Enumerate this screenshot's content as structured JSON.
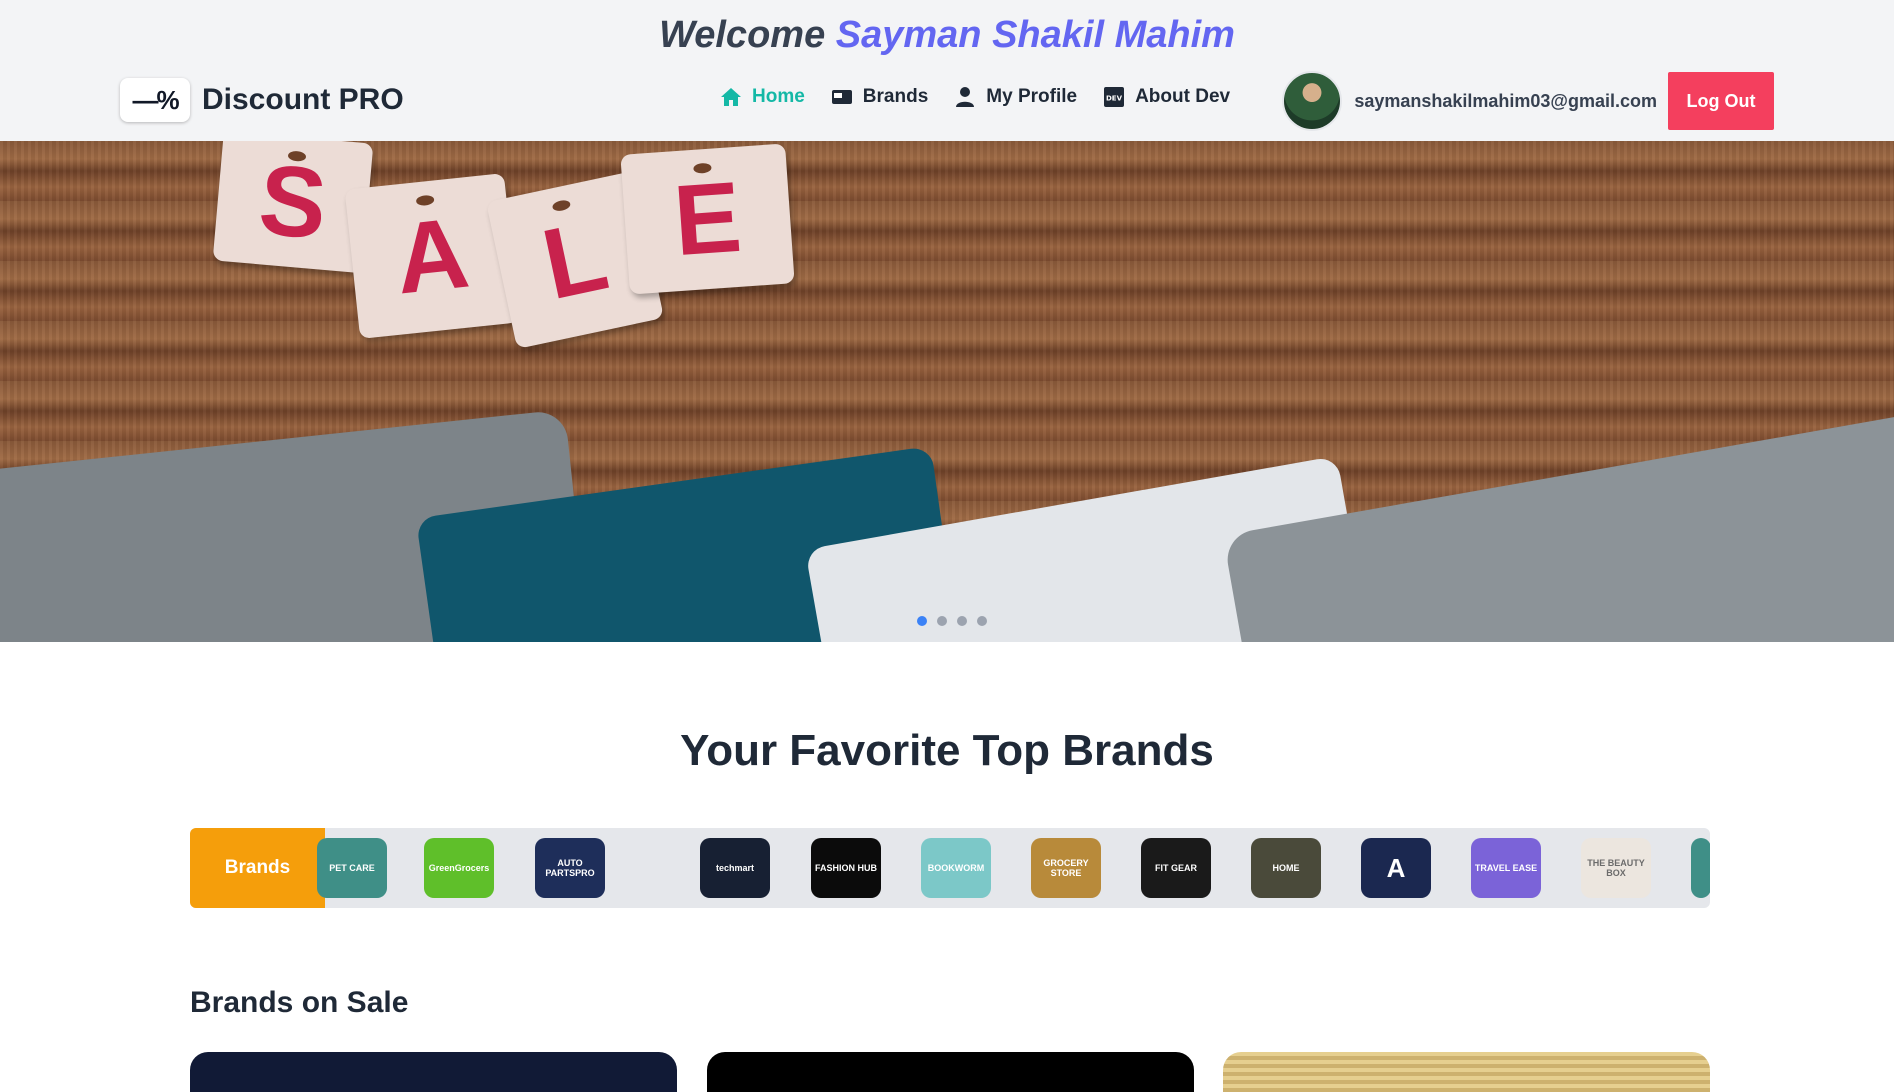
{
  "header": {
    "welcome_prefix": "Welcome",
    "user_name": "Sayman Shakil Mahim",
    "brand_name": "Discount PRO",
    "nav": [
      {
        "label": "Home",
        "icon": "home-icon",
        "active": true
      },
      {
        "label": "Brands",
        "icon": "card-icon",
        "active": false
      },
      {
        "label": "My Profile",
        "icon": "user-icon",
        "active": false
      },
      {
        "label": "About Dev",
        "icon": "dev-icon",
        "active": false
      }
    ],
    "email": "saymanshakilmahim03@gmail.com",
    "logout_label": "Log Out"
  },
  "hero": {
    "tag_letters": [
      "S",
      "A",
      "L",
      "E"
    ],
    "slides_total": 4,
    "active_slide": 1
  },
  "top_brands": {
    "title": "Your Favorite Top Brands",
    "label": "Brands",
    "logos": [
      {
        "name": "PET CARE",
        "color": "#3f8f87"
      },
      {
        "name": "GreenGrocers",
        "color": "#5fbf2a"
      },
      {
        "name": "AUTO PARTSPRO",
        "color": "#1e2e5a"
      },
      {
        "name": "techmart",
        "color": "#172033"
      },
      {
        "name": "FASHION HUB",
        "color": "#0b0b0b"
      },
      {
        "name": "BOOKWORM",
        "color": "#7cc8c8"
      },
      {
        "name": "GROCERY STORE",
        "color": "#b88a3a"
      },
      {
        "name": "FIT GEAR",
        "color": "#1a1a1a"
      },
      {
        "name": "HOME",
        "color": "#4a4a3a"
      },
      {
        "name": "A",
        "color": "#1b2850"
      },
      {
        "name": "TRAVEL EASE",
        "color": "#7b63d8"
      },
      {
        "name": "THE BEAUTY BOX",
        "color": "#ece6df"
      }
    ]
  },
  "brands_on_sale": {
    "title": "Brands on Sale"
  },
  "colors": {
    "accent": "#14b8a6",
    "welcome_name": "#6366f1",
    "logout": "#f43f5e",
    "brands_label": "#f59e0b"
  }
}
